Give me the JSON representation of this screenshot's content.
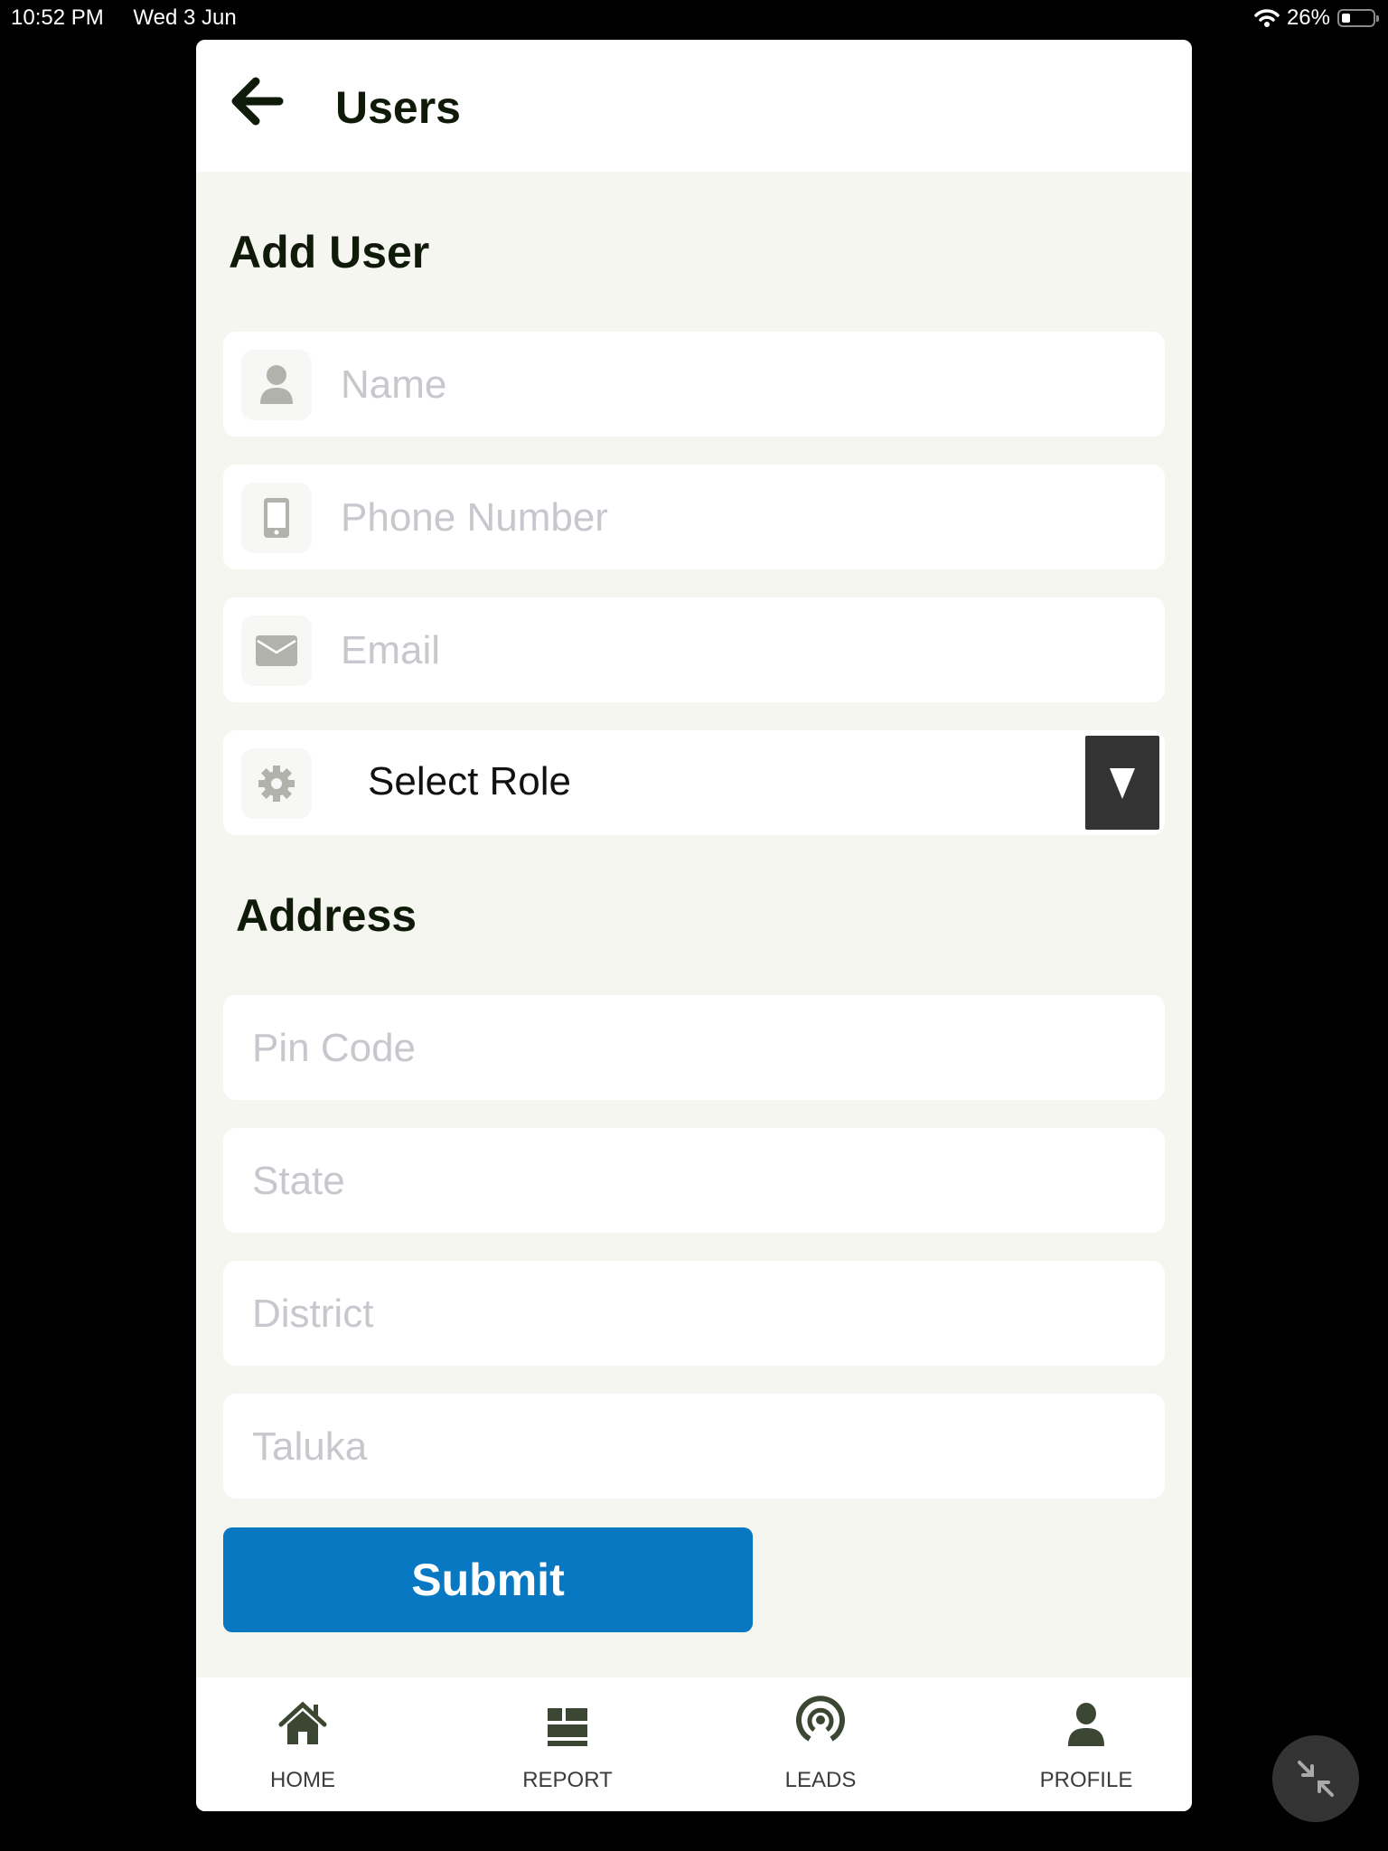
{
  "status_bar": {
    "time": "10:52 PM",
    "date": "Wed 3 Jun",
    "battery": "26%",
    "battery_level": 0.26
  },
  "header": {
    "title": "Users",
    "back_icon": "arrow-left-icon"
  },
  "form": {
    "title": "Add User",
    "fields": [
      {
        "name": "name",
        "placeholder": "Name",
        "value": "",
        "icon": "user-icon"
      },
      {
        "name": "phone",
        "placeholder": "Phone Number",
        "value": "",
        "icon": "mobile-phone-icon"
      },
      {
        "name": "email",
        "placeholder": "Email",
        "value": "",
        "icon": "envelope-icon"
      }
    ],
    "role": {
      "selected": "Select Role",
      "icon": "gear-icon",
      "dropdown_icon": "triangle-down-icon"
    }
  },
  "address": {
    "title": "Address",
    "fields": [
      {
        "name": "pin-code",
        "placeholder": "Pin Code",
        "value": ""
      },
      {
        "name": "state",
        "placeholder": "State",
        "value": ""
      },
      {
        "name": "district",
        "placeholder": "District",
        "value": ""
      },
      {
        "name": "taluka",
        "placeholder": "Taluka",
        "value": ""
      }
    ]
  },
  "submit_label": "Submit",
  "nav": [
    {
      "label": "HOME",
      "icon": "home-icon"
    },
    {
      "label": "REPORT",
      "icon": "report-icon"
    },
    {
      "label": "LEADS",
      "icon": "broadcast-icon"
    },
    {
      "label": "PROFILE",
      "icon": "user-icon"
    }
  ],
  "colors": {
    "accent": "#0878c2",
    "background": "#f6f6f1",
    "nav_icon": "#3b4733"
  }
}
